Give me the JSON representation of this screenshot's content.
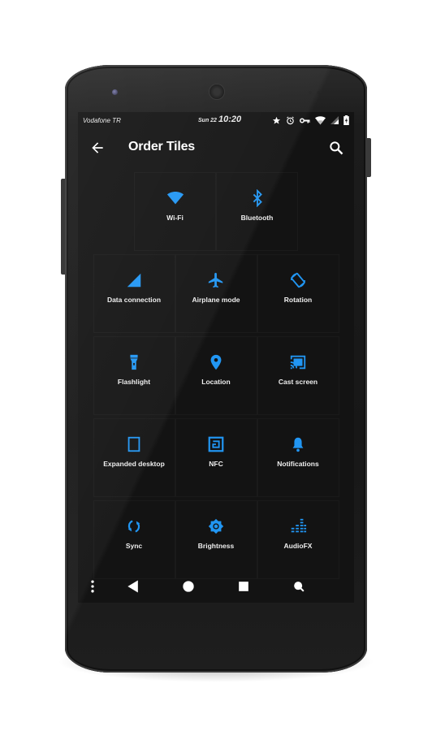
{
  "status_bar": {
    "carrier": "Vodafone TR",
    "date": "Sun 22",
    "time": "10:20",
    "icons": [
      "star-icon",
      "alarm-icon",
      "vpn-key-icon",
      "wifi-signal-icon",
      "cell-signal-icon",
      "battery-charging-icon"
    ]
  },
  "toolbar": {
    "title": "Order Tiles",
    "back_icon": "arrow-back-icon",
    "search_icon": "search-icon"
  },
  "accent_color": "#2196f3",
  "tiles": [
    {
      "label": "Wi-Fi",
      "icon": "wifi-icon"
    },
    {
      "label": "Bluetooth",
      "icon": "bluetooth-icon"
    },
    {
      "label": "Data connection",
      "icon": "cell-signal-icon"
    },
    {
      "label": "Airplane mode",
      "icon": "airplane-icon"
    },
    {
      "label": "Rotation",
      "icon": "rotation-icon"
    },
    {
      "label": "Flashlight",
      "icon": "flashlight-icon"
    },
    {
      "label": "Location",
      "icon": "location-pin-icon"
    },
    {
      "label": "Cast screen",
      "icon": "cast-icon"
    },
    {
      "label": "Expanded desktop",
      "icon": "expanded-desktop-icon"
    },
    {
      "label": "NFC",
      "icon": "nfc-icon"
    },
    {
      "label": "Notifications",
      "icon": "bell-icon"
    },
    {
      "label": "Sync",
      "icon": "sync-icon"
    },
    {
      "label": "Brightness",
      "icon": "brightness-icon"
    },
    {
      "label": "AudioFX",
      "icon": "equalizer-icon"
    }
  ],
  "nav_bar": [
    "menu-dots-icon",
    "back-triangle-icon",
    "home-circle-icon",
    "recents-square-icon",
    "search-icon"
  ]
}
